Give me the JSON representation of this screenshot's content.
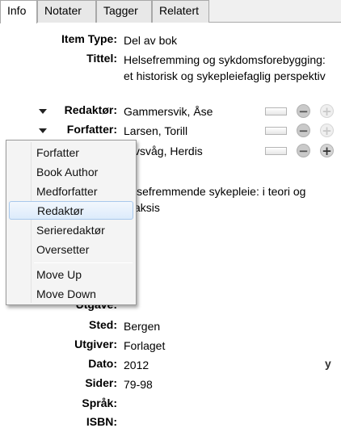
{
  "tabs": [
    "Info",
    "Notater",
    "Tagger",
    "Relatert"
  ],
  "fields": {
    "item_type": {
      "label": "Item Type:",
      "value": "Del av bok"
    },
    "title": {
      "label": "Tittel:",
      "value": "Helsefremming og sykdomsforebygging: et historisk og sykepleiefaglig perspektiv"
    },
    "creators": [
      {
        "label": "Redaktør:",
        "value": "Gammersvik, Åse"
      },
      {
        "label": "Forfatter:",
        "value": "Larsen, Torill"
      },
      {
        "value": "vsvåg, Herdis"
      }
    ],
    "book_title_partial": "lsefremmende sykepleie: i teori og aksis",
    "edition": {
      "label": "Utgave:",
      "value": ""
    },
    "place": {
      "label": "Sted:",
      "value": "Bergen"
    },
    "publisher": {
      "label": "Utgiver:",
      "value": "Forlaget"
    },
    "date": {
      "label": "Dato:",
      "value": "2012",
      "marker": "y"
    },
    "pages": {
      "label": "Sider:",
      "value": "79-98"
    },
    "language": {
      "label": "Språk:",
      "value": ""
    },
    "isbn": {
      "label": "ISBN:",
      "value": ""
    }
  },
  "context_menu": {
    "items": [
      "Forfatter",
      "Book Author",
      "Medforfatter",
      "Redaktør",
      "Serieredaktør",
      "Oversetter"
    ],
    "highlighted": "Redaktør",
    "actions": [
      "Move Up",
      "Move Down"
    ]
  },
  "colors": {
    "menu_highlight": "#dcebfb",
    "menu_highlight_border": "#a8c8ec"
  }
}
